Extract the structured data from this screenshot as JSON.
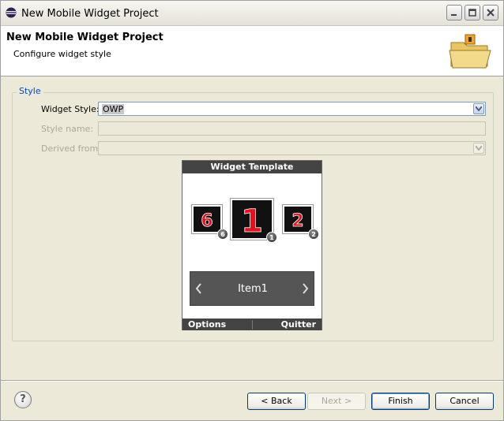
{
  "window": {
    "title": "New Mobile Widget Project",
    "controls": [
      "minimize-icon",
      "maximize-icon",
      "close-icon"
    ]
  },
  "banner": {
    "title": "New Mobile Widget Project",
    "subtitle": "Configure widget style",
    "image": "folder-wizard-icon"
  },
  "group": {
    "label": "Style",
    "widget_style_label": "Widget Style:",
    "widget_style_value": "OWP",
    "style_name_label": "Style name:",
    "style_name_value": "",
    "derived_from_label": "Derived from:",
    "derived_from_value": ""
  },
  "preview": {
    "header": "Widget Template",
    "tiles": [
      "6",
      "1",
      "2"
    ],
    "tile_badges": [
      "6",
      "1",
      "2"
    ],
    "carousel_item": "Item1",
    "softkey_left": "Options",
    "softkey_right": "Quitter"
  },
  "buttons": {
    "help": "?",
    "back": "< Back",
    "next": "Next >",
    "finish": "Finish",
    "cancel": "Cancel"
  },
  "colors": {
    "accent": "#0046d5",
    "tile_digit": "#e8101a",
    "preview_bar": "#444444"
  }
}
